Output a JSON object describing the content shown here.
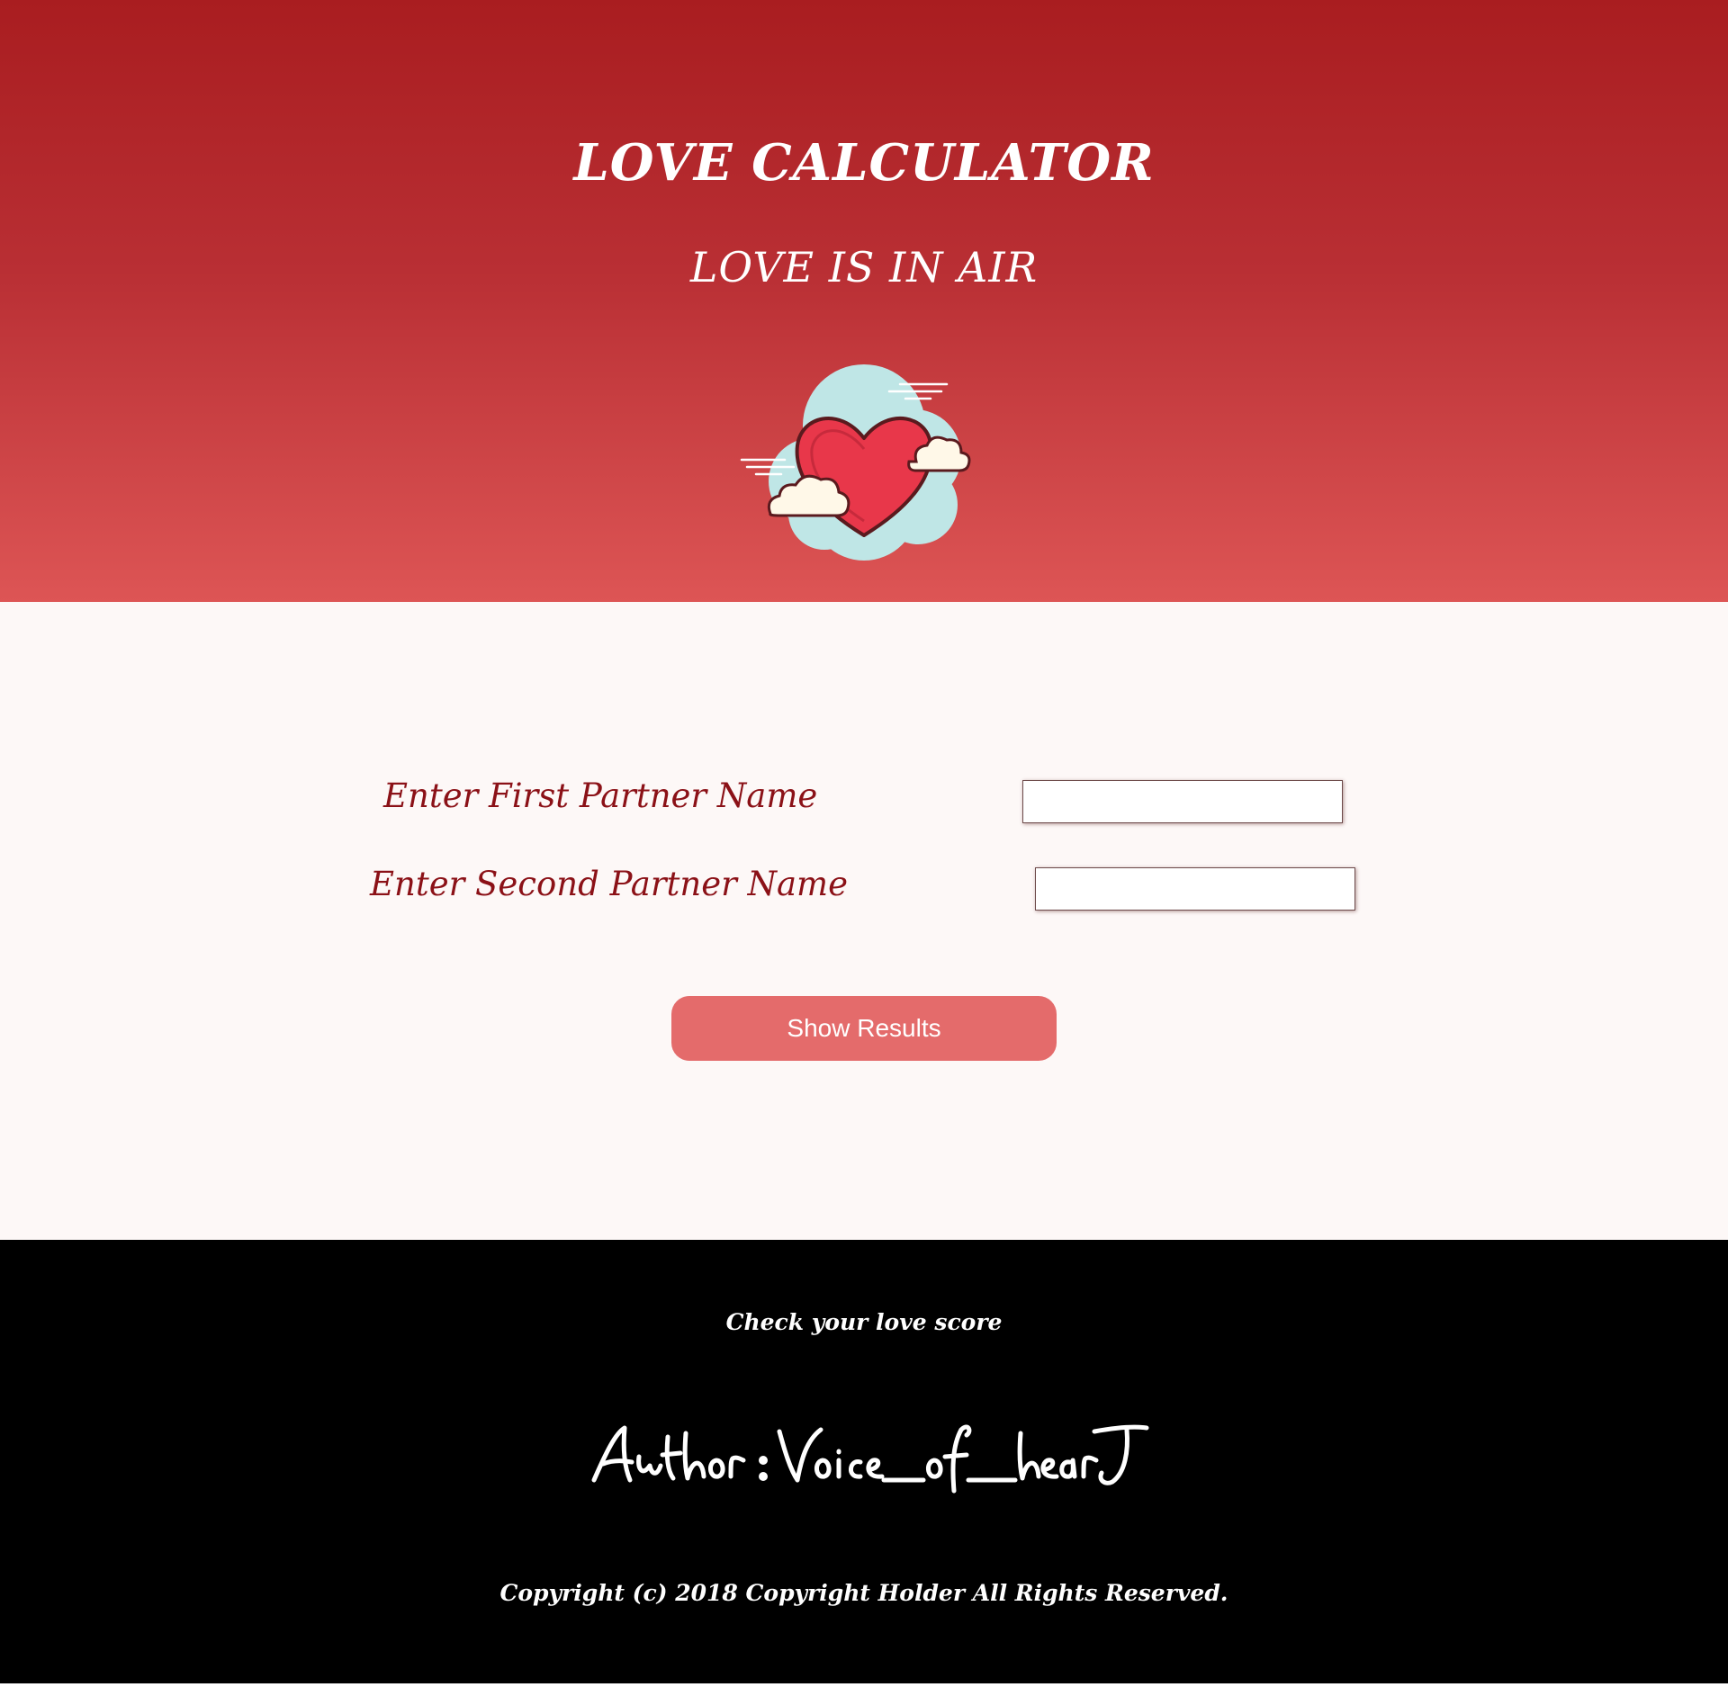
{
  "header": {
    "title": "LOVE CALCULATOR",
    "subtitle": "LOVE IS IN AIR",
    "illustration_icon": "heart-with-clouds-icon"
  },
  "form": {
    "first_label": "Enter First Partner Name",
    "second_label": "Enter Second Partner Name",
    "first_value": "",
    "second_value": "",
    "button_label": "Show Results"
  },
  "footer": {
    "tagline": "Check your love score",
    "author_signature": "Author : Voice__of__hearT",
    "copyright": "Copyright (c) 2018 Copyright Holder All Rights Reserved."
  },
  "colors": {
    "header_top": "#a91d20",
    "header_bottom": "#dd5555",
    "label_text": "#8b1117",
    "button": "#e46b6b",
    "main_background": "#fdf8f7",
    "footer_background": "#000000"
  }
}
